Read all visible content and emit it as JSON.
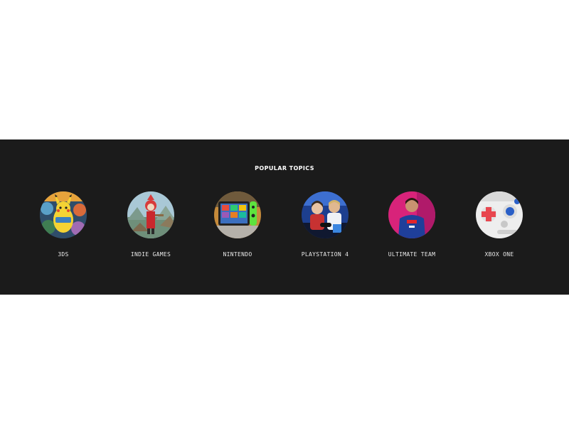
{
  "popular_topics": {
    "title": "POPULAR TOPICS",
    "items": [
      {
        "label": "3DS"
      },
      {
        "label": "INDIE GAMES"
      },
      {
        "label": "NINTENDO"
      },
      {
        "label": "PLAYSTATION 4"
      },
      {
        "label": "ULTIMATE TEAM"
      },
      {
        "label": "XBOX ONE"
      }
    ]
  },
  "colors": {
    "band_background": "#1b1b1b",
    "page_background": "#ffffff",
    "title_text": "#ffffff",
    "label_text": "#e9e9e9"
  }
}
